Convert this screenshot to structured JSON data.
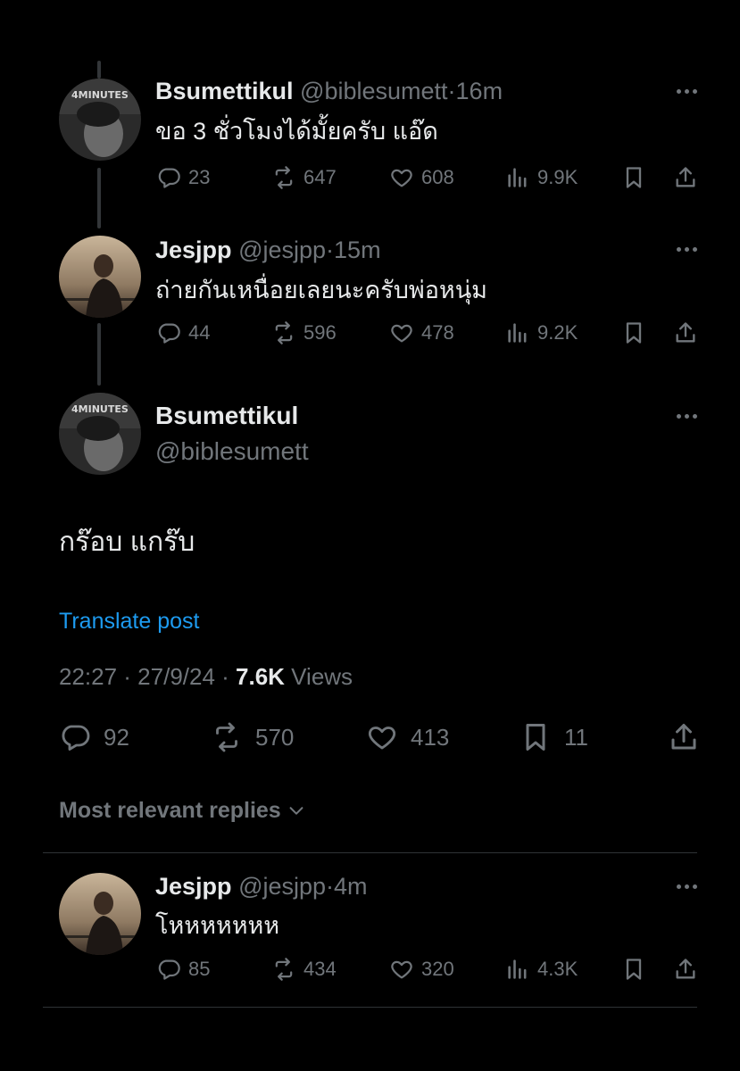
{
  "thread": [
    {
      "name": "Bsumettikul",
      "handle": "@biblesumett",
      "dot": "·",
      "time": "16m",
      "text": "ขอ 3 ชั่วโมงได้มั้ยครับ แอ๊ด",
      "replies": "23",
      "reposts": "647",
      "likes": "608",
      "views": "9.9K"
    },
    {
      "name": "Jesjpp",
      "handle": "@jesjpp",
      "dot": "·",
      "time": "15m",
      "text": "ถ่ายกันเหนื่อยเลยนะครับพ่อหนุ่ม",
      "replies": "44",
      "reposts": "596",
      "likes": "478",
      "views": "9.2K"
    }
  ],
  "focus": {
    "name": "Bsumettikul",
    "handle": "@biblesumett",
    "text": "กร๊อบ แกร๊บ",
    "translate": "Translate post",
    "timestamp": "22:27 · 27/9/24 · ",
    "views_count": "7.6K",
    "views_label": " Views",
    "replies": "92",
    "reposts": "570",
    "likes": "413",
    "bookmarks": "11"
  },
  "sort_label": "Most relevant replies",
  "reply": {
    "name": "Jesjpp",
    "handle": "@jesjpp",
    "dot": "·",
    "time": "4m",
    "text": "โหหหหหหห",
    "replies": "85",
    "reposts": "434",
    "likes": "320",
    "views": "4.3K"
  },
  "avatar_text": "4MINUTES"
}
